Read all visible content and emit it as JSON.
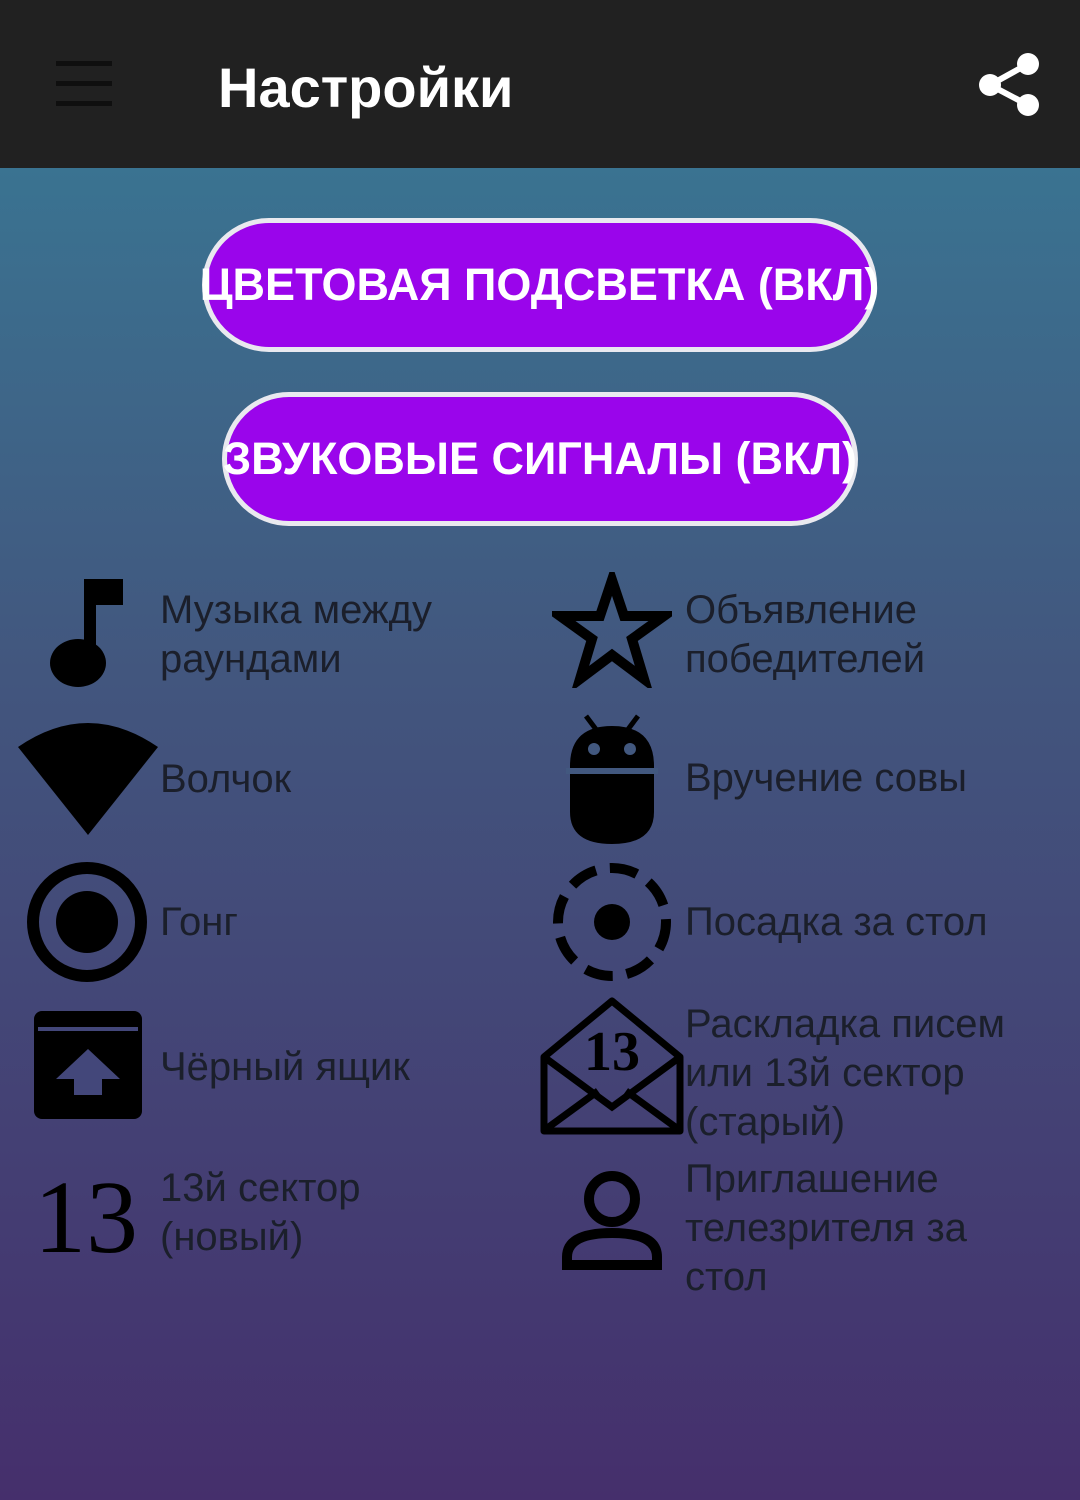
{
  "app_bar": {
    "title": "Настройки",
    "menu_icon": "hamburger-menu-icon",
    "share_icon": "share-icon"
  },
  "toggles": [
    {
      "label": "ЦВЕТОВАЯ ПОДСВЕТКА (ВКЛ)"
    },
    {
      "label": "ЗВУКОВЫЕ СИГНАЛЫ (ВКЛ)"
    }
  ],
  "options": [
    {
      "label": "Музыка между раундами",
      "icon": "music-note-icon"
    },
    {
      "label": "Объявление победителей",
      "icon": "star-outline-icon"
    },
    {
      "label": "Волчок",
      "icon": "wifi-signal-icon"
    },
    {
      "label": "Вручение совы",
      "icon": "android-icon"
    },
    {
      "label": "Гонг",
      "icon": "radio-button-icon"
    },
    {
      "label": "Посадка за стол",
      "icon": "dashed-target-icon"
    },
    {
      "label": "Чёрный ящик",
      "icon": "archive-up-icon"
    },
    {
      "label": "Раскладка писем или 13й сектор (старый)",
      "icon": "envelope-13-icon",
      "icon_text": "13"
    },
    {
      "label": "13й сектор (новый)",
      "icon": "number-13-icon",
      "icon_text": "13"
    },
    {
      "label": "Приглашение телезрителя за стол",
      "icon": "person-outline-icon"
    }
  ],
  "colors": {
    "app_bar": "#212121",
    "button_fill": "#9a05eb",
    "button_border": "#e9e9ef",
    "gradient_top": "#3a7391",
    "gradient_bottom": "#452f6c",
    "label_text": "#1b1f2b"
  }
}
